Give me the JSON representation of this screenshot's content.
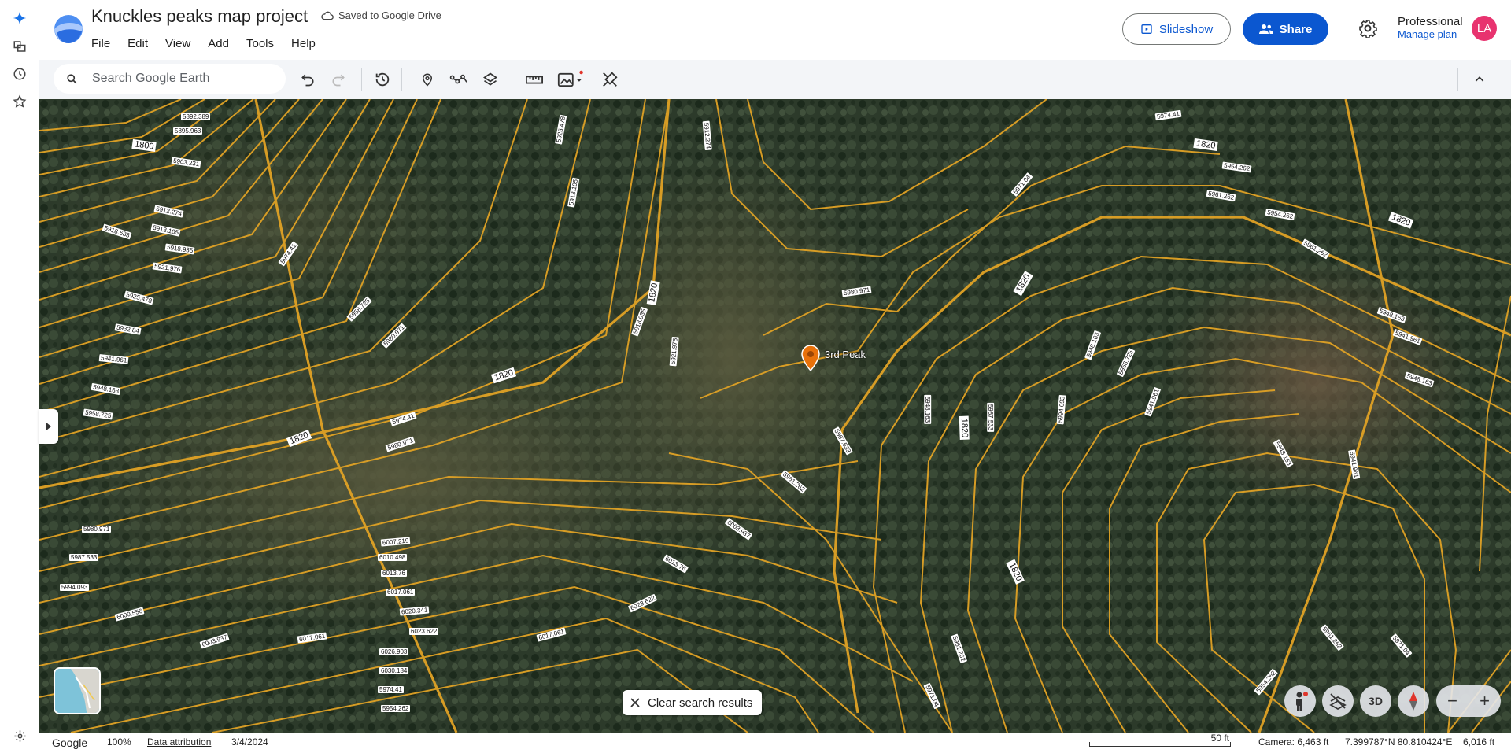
{
  "app": {
    "title": "Knuckles peaks map project",
    "saved_status": "Saved to Google Drive"
  },
  "menu": [
    "File",
    "Edit",
    "View",
    "Add",
    "Tools",
    "Help"
  ],
  "header": {
    "slideshow_label": "Slideshow",
    "share_label": "Share",
    "plan_name": "Professional",
    "plan_link": "Manage plan",
    "avatar_initials": "LA"
  },
  "search": {
    "placeholder": "Search Google Earth"
  },
  "toolbar_icons": [
    "undo-icon",
    "redo-icon",
    "history-icon",
    "placemark-icon",
    "path-icon",
    "layers-icon",
    "ruler-icon",
    "image-overlay-icon",
    "edit-tools-icon",
    "collapse-icon"
  ],
  "map": {
    "placemark_label": "3rd Peak",
    "contour_labels": [
      "1820",
      "1800"
    ],
    "elevation_labels": [
      "5892.389",
      "5895.963",
      "5903.231",
      "5912.274",
      "5913.105",
      "5918.633",
      "5918.935",
      "5921.976",
      "5925.478",
      "5932.84",
      "5941.961",
      "5948.163",
      "5958.725",
      "5980.971",
      "5987.533",
      "5994.093",
      "6000.556",
      "6003.937",
      "6007.219",
      "6010.498",
      "6013.76",
      "6017.061",
      "6020.341",
      "6023.622",
      "6026.903",
      "6030.184",
      "5974.41",
      "5954.262",
      "5961.262",
      "5971.04"
    ],
    "clear_button": "Clear search results",
    "view_mode": "3D"
  },
  "status_bar": {
    "brand": "Google",
    "zoom": "100%",
    "attribution": "Data attribution",
    "date": "3/4/2024",
    "scale": "50 ft",
    "camera": "Camera: 6,463 ft",
    "coordinates": "7.399787°N 80.810424°E",
    "elevation": "6,016 ft"
  },
  "colors": {
    "accent": "#0b57d0",
    "contour": "#e0a225",
    "avatar": "#e8336f",
    "placemark": "#e8710a"
  }
}
